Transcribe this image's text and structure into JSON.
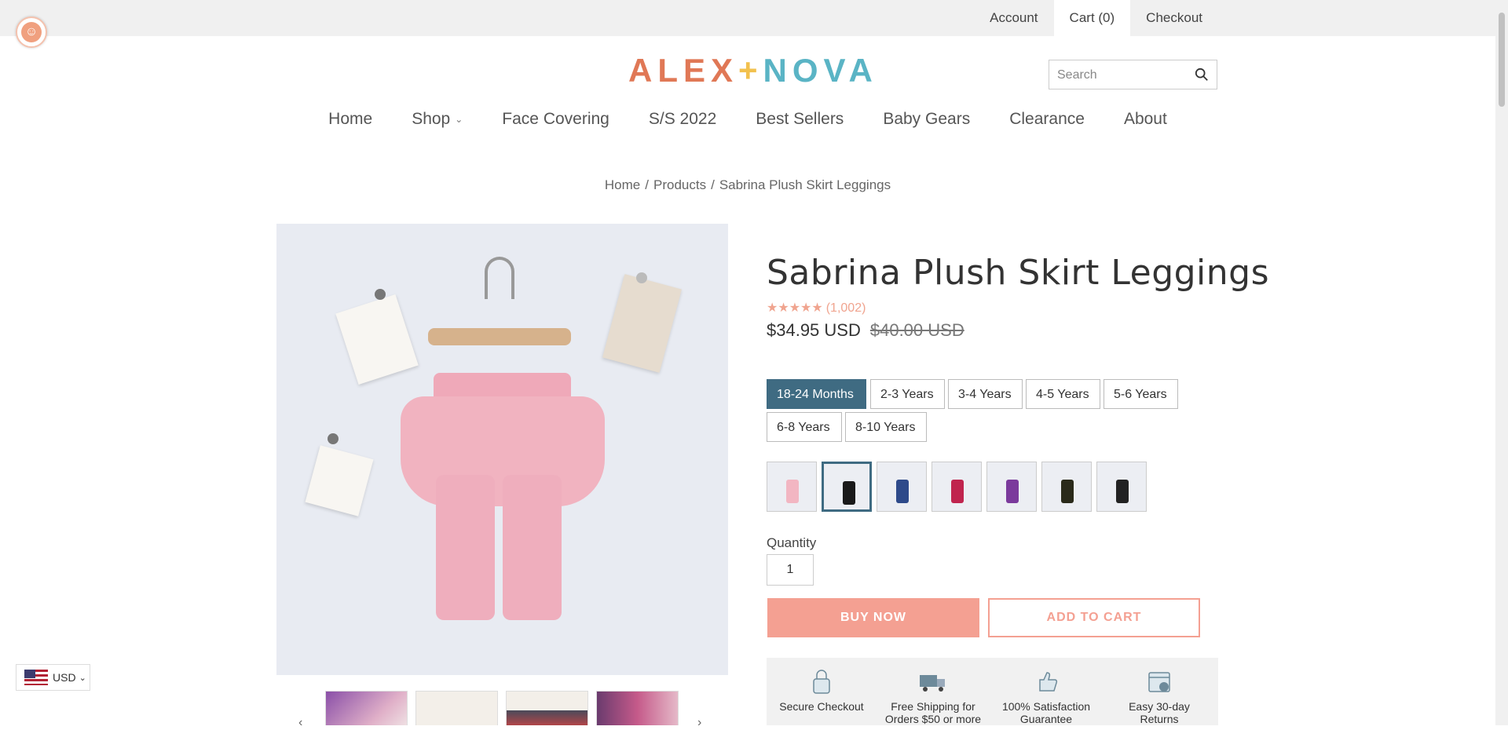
{
  "topbar": {
    "account": "Account",
    "cart": "Cart (0)",
    "checkout": "Checkout"
  },
  "logo": {
    "part1": "ALEX",
    "plus": "+",
    "part2": "NOVA"
  },
  "search": {
    "placeholder": "Search"
  },
  "nav": [
    "Home",
    "Shop",
    "Face Covering",
    "S/S 2022",
    "Best Sellers",
    "Baby Gears",
    "Clearance",
    "About"
  ],
  "breadcrumb": [
    "Home",
    "Products",
    "Sabrina Plush Skirt Leggings"
  ],
  "breadcrumb_sep": "/",
  "product": {
    "title": "Sabrina Plush Skirt Leggings",
    "stars": "★★★★★",
    "review_count": "(1,002)",
    "price": "$34.95 USD",
    "compare_price": "$40.00 USD",
    "sizes": [
      "18-24 Months",
      "2-3 Years",
      "3-4 Years",
      "4-5 Years",
      "5-6 Years",
      "6-8 Years",
      "8-10 Years"
    ],
    "selected_size": "18-24 Months",
    "swatch_colors": [
      "#f2b6c2",
      "#1a1a1a",
      "#2e4a8a",
      "#c0244e",
      "#7b3a9c",
      "#2a2a1a",
      "#222"
    ],
    "quantity_label": "Quantity",
    "quantity": "1",
    "buy_now": "BUY NOW",
    "add_to_cart": "ADD TO CART"
  },
  "trust": [
    {
      "icon": "lock-icon",
      "line1": "Secure Checkout",
      "line2": ""
    },
    {
      "icon": "truck-icon",
      "line1": "Free Shipping for",
      "line2": "Orders $50 or more"
    },
    {
      "icon": "thumbs-up-icon",
      "line1": "100% Satisfaction",
      "line2": "Guarantee"
    },
    {
      "icon": "calendar-icon",
      "line1": "Easy 30-day",
      "line2": "Returns"
    }
  ],
  "currency": {
    "code": "USD"
  },
  "colors": {
    "accent": "#f4a092",
    "selected": "#3f6b82"
  }
}
